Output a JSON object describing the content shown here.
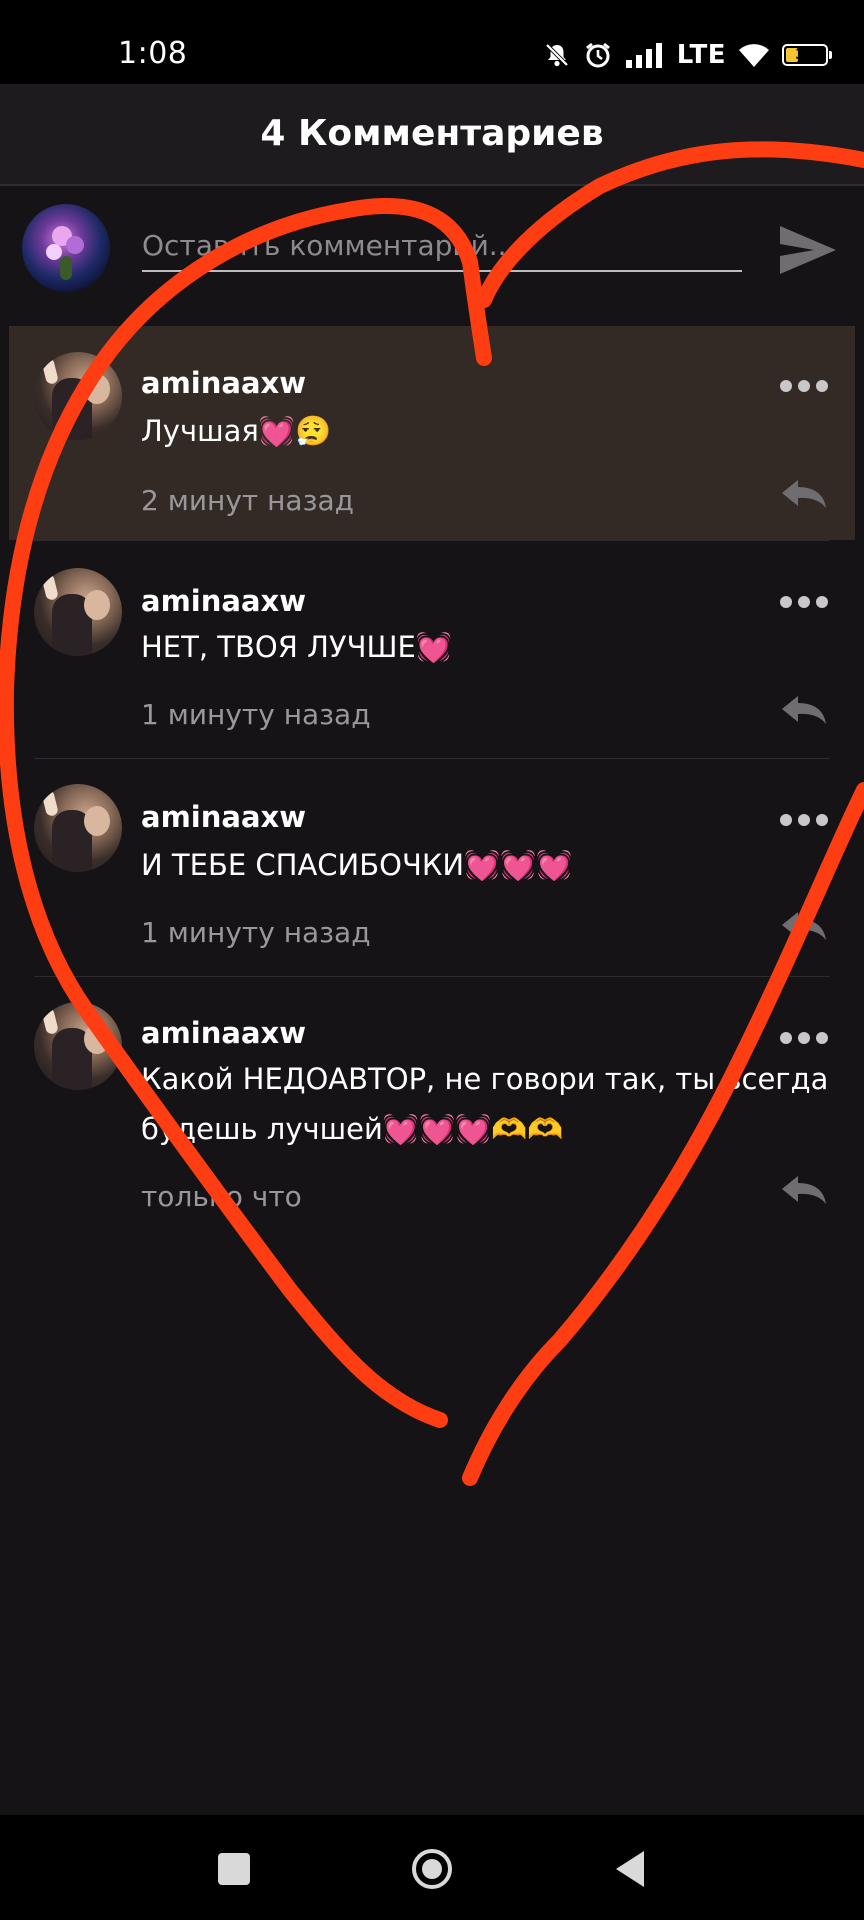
{
  "status_bar": {
    "time": "1:08",
    "network": "LTE",
    "battery_level": "32",
    "battery_fraction": 0.32,
    "icons": [
      "mute-icon",
      "alarm-icon",
      "signal-icon",
      "wifi-icon",
      "battery-icon"
    ]
  },
  "header": {
    "title": "4 Комментариев"
  },
  "composer": {
    "placeholder": "Оставить комментарий...",
    "send_icon": "send-icon"
  },
  "comments": [
    {
      "username": "aminaaxw",
      "text": "Лучшая💓😮‍💨",
      "time": "2 минут назад",
      "highlighted": true
    },
    {
      "username": "aminaaxw",
      "text": "НЕТ, ТВОЯ ЛУЧШЕ💓",
      "time": "1 минуту назад",
      "highlighted": false
    },
    {
      "username": "aminaaxw",
      "text": "И ТЕБЕ СПАСИБОЧКИ💓💓💓",
      "time": "1 минуту назад",
      "highlighted": false
    },
    {
      "username": "aminaaxw",
      "text": "Какой НЕДОАВТОР, не говори так, ты всегда будешь лучшей💓💓💓🫶🫶",
      "time": "только что",
      "highlighted": false
    }
  ],
  "colors": {
    "background": "#151316",
    "highlight": "#332a25",
    "drawing": "#ff3d12"
  },
  "nav": {
    "icons": [
      "recent-apps-icon",
      "home-icon",
      "back-icon"
    ]
  }
}
